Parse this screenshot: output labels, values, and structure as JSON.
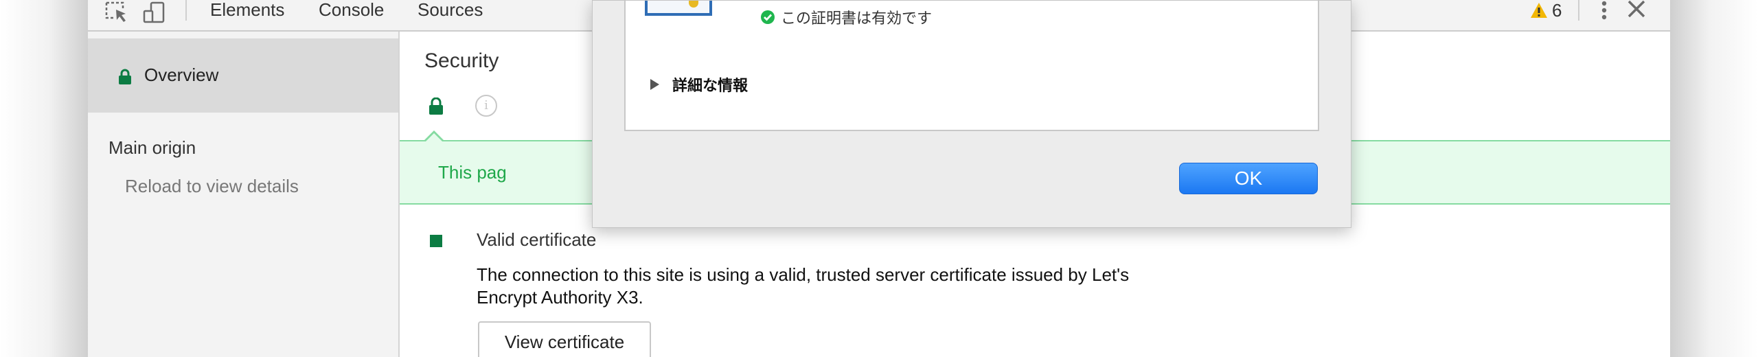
{
  "toolbar": {
    "tabs": [
      "Elements",
      "Console",
      "Sources"
    ],
    "warning_count": "6",
    "icons": [
      "inspect-element-icon",
      "device-toolbar-icon",
      "warning-icon",
      "kebab-menu-icon",
      "close-icon"
    ]
  },
  "sidebar": {
    "overview_label": "Overview",
    "main_origin_label": "Main origin",
    "reload_label": "Reload to view details"
  },
  "main": {
    "title": "Security",
    "banner_text": "This pag",
    "certificate": {
      "title": "Valid certificate",
      "description": "The connection to this site is using a valid, trusted server certificate issued by Let's Encrypt Authority X3.",
      "button_label": "View certificate"
    }
  },
  "dialog": {
    "valid_text": "この証明書は有効です",
    "details_label": "詳細な情報",
    "ok_label": "OK"
  },
  "colors": {
    "secure_green": "#0c7c43",
    "banner_bg": "#e6fbec",
    "banner_text": "#1fa84a",
    "ok_blue": "#1b78f2",
    "warning_yellow": "#f2b705"
  }
}
